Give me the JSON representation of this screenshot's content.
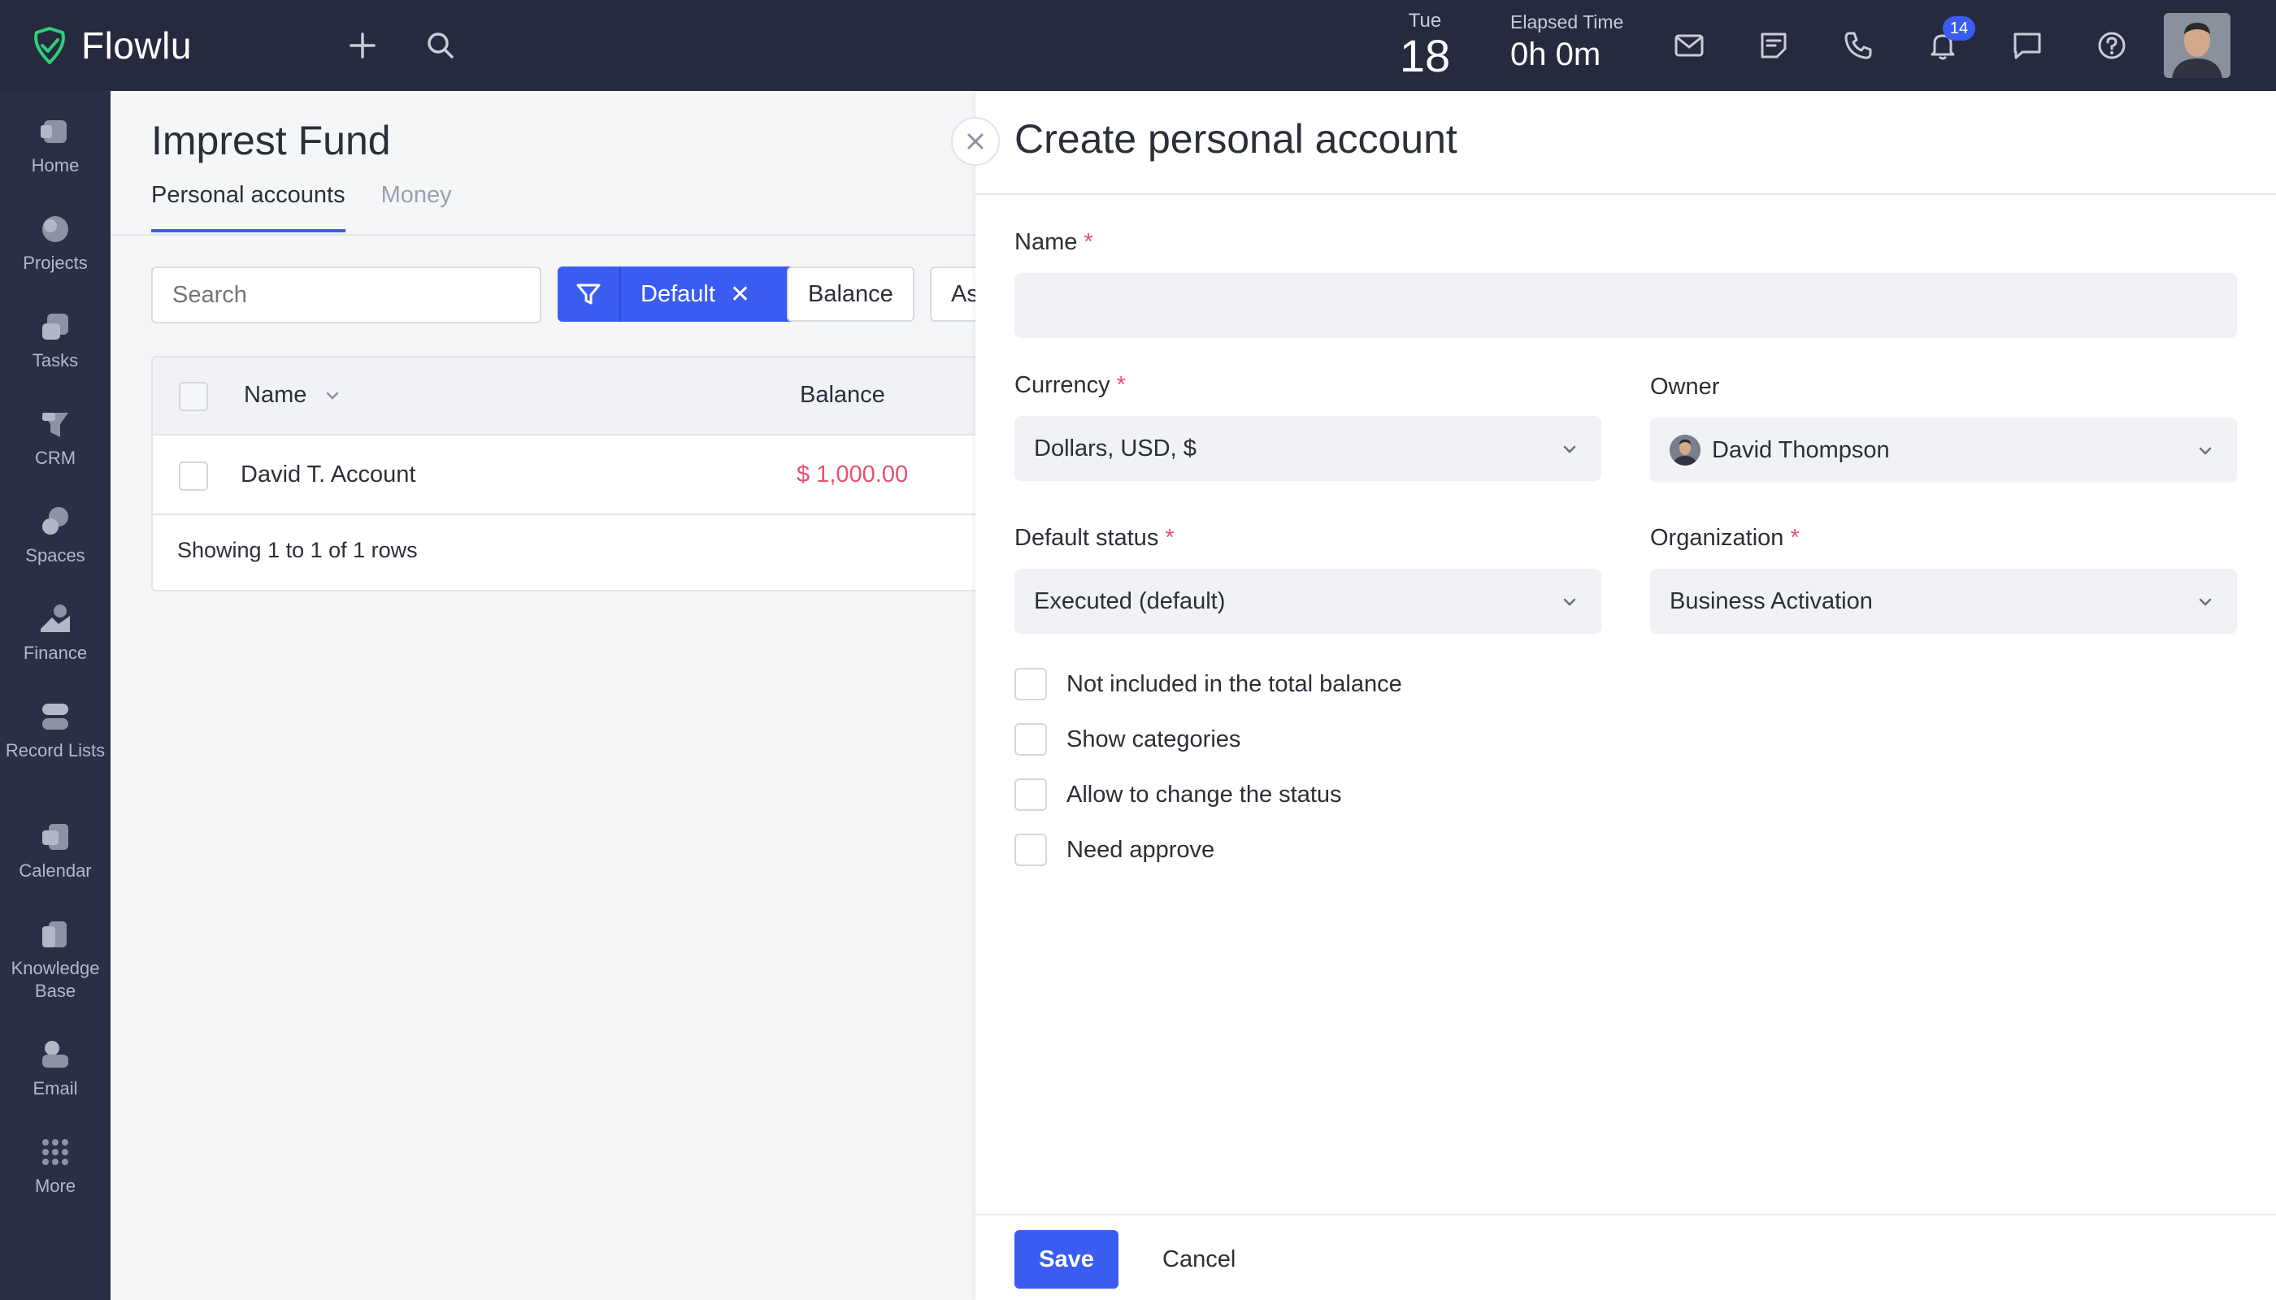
{
  "topbar": {
    "logo_text": "Flowlu",
    "date_dow": "Tue",
    "date_day": "18",
    "elapsed_label": "Elapsed Time",
    "elapsed_value": "0h 0m",
    "notification_count": "14"
  },
  "sidebar": {
    "items": [
      {
        "label": "Home",
        "icon": "home-icon"
      },
      {
        "label": "Projects",
        "icon": "projects-icon"
      },
      {
        "label": "Tasks",
        "icon": "tasks-icon"
      },
      {
        "label": "CRM",
        "icon": "crm-icon"
      },
      {
        "label": "Spaces",
        "icon": "spaces-icon"
      },
      {
        "label": "Finance",
        "icon": "finance-icon"
      },
      {
        "label": "Record Lists",
        "icon": "record-lists-icon"
      },
      {
        "label": "Calendar",
        "icon": "calendar-icon"
      },
      {
        "label": "Knowledge Base",
        "icon": "knowledge-base-icon"
      },
      {
        "label": "Email",
        "icon": "email-icon"
      },
      {
        "label": "More",
        "icon": "more-icon"
      }
    ]
  },
  "page": {
    "title": "Imprest Fund",
    "tabs": [
      {
        "label": "Personal accounts",
        "active": true
      },
      {
        "label": "Money",
        "active": false
      }
    ],
    "search_placeholder": "Search",
    "filter_label": "Default",
    "chips": [
      "Balance",
      "As"
    ]
  },
  "table": {
    "headers": {
      "name": "Name",
      "balance": "Balance"
    },
    "rows": [
      {
        "name": "David T. Account",
        "balance": "$ 1,000.00"
      }
    ],
    "footer": "Showing 1 to 1 of 1 rows"
  },
  "modal": {
    "title": "Create personal account",
    "fields": {
      "name_label": "Name",
      "name_value": "",
      "currency_label": "Currency",
      "currency_value": "Dollars, USD, $",
      "owner_label": "Owner",
      "owner_value": "David Thompson",
      "default_status_label": "Default status",
      "default_status_value": "Executed (default)",
      "organization_label": "Organization",
      "organization_value": "Business Activation"
    },
    "required_mark": "*",
    "checkboxes": [
      "Not included in the total balance",
      "Show categories",
      "Allow to change the status",
      "Need approve"
    ],
    "save_label": "Save",
    "cancel_label": "Cancel"
  },
  "colors": {
    "topbar_bg": "#262a3e",
    "sidebar_bg": "#2b2f45",
    "accent": "#3b5cf0",
    "money_red": "#e8516e"
  }
}
